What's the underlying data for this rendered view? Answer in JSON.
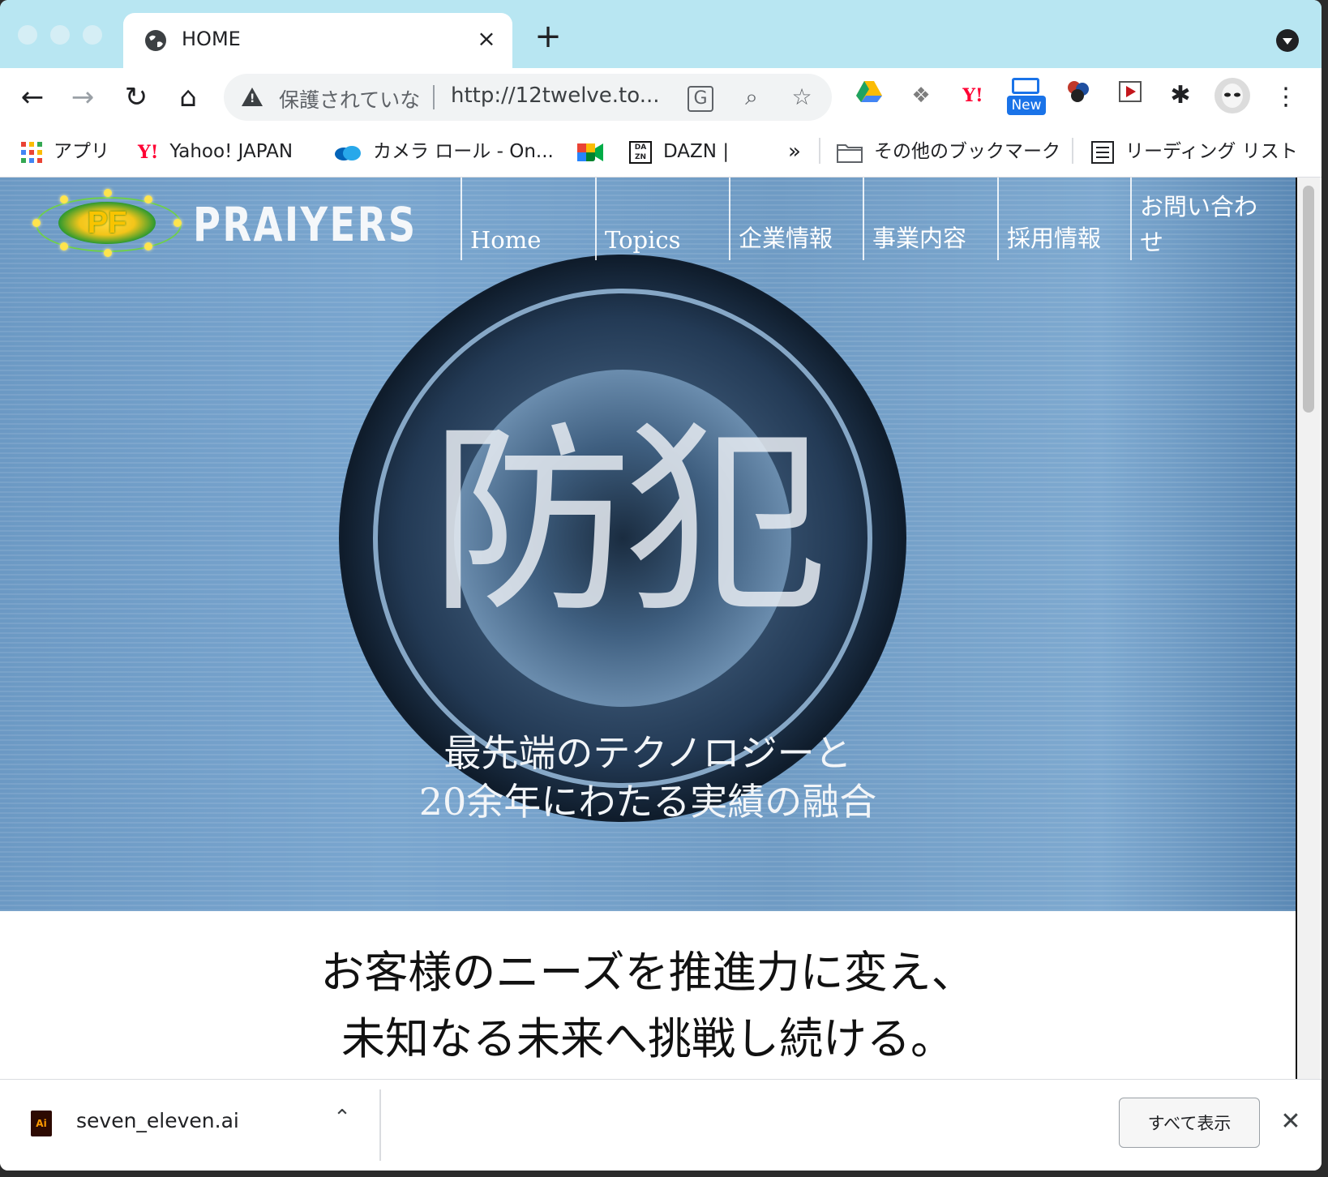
{
  "browser": {
    "tab": {
      "title": "HOME",
      "close": "×"
    },
    "new_tab": "+",
    "omnibox": {
      "security_text": "保護されていな",
      "url": "http://12twelve.to..."
    },
    "extensions": {
      "new_badge": "New"
    },
    "bookmarks": [
      {
        "label": "アプリ",
        "icon": "apps-grid-icon"
      },
      {
        "label": "Yahoo! JAPAN",
        "icon": "yahoo-icon"
      },
      {
        "label": "カメラ ロール - On...",
        "icon": "onedrive-icon"
      },
      {
        "label": "",
        "icon": "google-meet-icon"
      },
      {
        "label": "DAZN |",
        "icon": "dazn-icon"
      }
    ],
    "bookmarks_overflow": "»",
    "other_bookmarks": "その他のブックマーク",
    "reading_list": "リーディング リスト"
  },
  "site": {
    "brand": "PRAIYERS",
    "logo_text": "PF",
    "nav": [
      "Home",
      "Topics",
      "企業情報",
      "事業内容",
      "採用情報",
      "お問い合わせ"
    ],
    "hero": {
      "headline": "防犯",
      "sub_line1": "最先端のテクノロジーと",
      "sub_line2": "20余年にわたる実績の融合"
    },
    "tagline_line1": "お客様のニーズを推進力に変え、",
    "tagline_line2": "未知なる未来へ挑戦し続ける。"
  },
  "downloads": {
    "file_name": "seven_eleven.ai",
    "file_icon_text": "Ai",
    "show_all": "すべて表示",
    "close": "✕"
  }
}
